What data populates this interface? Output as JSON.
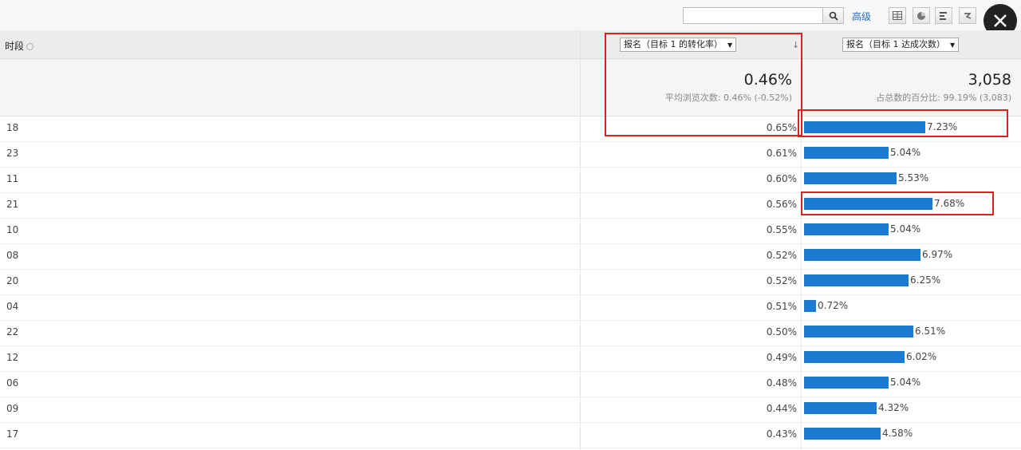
{
  "toolbar": {
    "search_value": "",
    "advanced_label": "高级",
    "view_icons": [
      "table-view-icon",
      "pie-view-icon",
      "bar-view-icon",
      "compare-view-icon"
    ]
  },
  "header": {
    "dimension_label": "时段",
    "metric1_label": "报名（目标 1 的转化率）",
    "metric2_label": "报名（目标 1 达成次数）",
    "sort_indicator": "↓"
  },
  "summary": {
    "metric1_value": "0.46%",
    "metric1_sub": "平均浏览次数: 0.46% (-0.52%)",
    "metric2_value": "3,058",
    "metric2_sub": "占总数的百分比: 99.19% (3,083)"
  },
  "rows": [
    {
      "dim": "18",
      "rate": "0.65%",
      "share": "7.23%",
      "share_num": 7.23
    },
    {
      "dim": "23",
      "rate": "0.61%",
      "share": "5.04%",
      "share_num": 5.04
    },
    {
      "dim": "11",
      "rate": "0.60%",
      "share": "5.53%",
      "share_num": 5.53
    },
    {
      "dim": "21",
      "rate": "0.56%",
      "share": "7.68%",
      "share_num": 7.68
    },
    {
      "dim": "10",
      "rate": "0.55%",
      "share": "5.04%",
      "share_num": 5.04
    },
    {
      "dim": "08",
      "rate": "0.52%",
      "share": "6.97%",
      "share_num": 6.97
    },
    {
      "dim": "20",
      "rate": "0.52%",
      "share": "6.25%",
      "share_num": 6.25
    },
    {
      "dim": "04",
      "rate": "0.51%",
      "share": "0.72%",
      "share_num": 0.72
    },
    {
      "dim": "22",
      "rate": "0.50%",
      "share": "6.51%",
      "share_num": 6.51
    },
    {
      "dim": "12",
      "rate": "0.49%",
      "share": "6.02%",
      "share_num": 6.02
    },
    {
      "dim": "06",
      "rate": "0.48%",
      "share": "5.04%",
      "share_num": 5.04
    },
    {
      "dim": "09",
      "rate": "0.44%",
      "share": "4.32%",
      "share_num": 4.32
    },
    {
      "dim": "17",
      "rate": "0.43%",
      "share": "4.58%",
      "share_num": 4.58
    }
  ],
  "colors": {
    "bar": "#1b7bd0",
    "highlight": "#e02020",
    "link": "#2a6cc4"
  }
}
